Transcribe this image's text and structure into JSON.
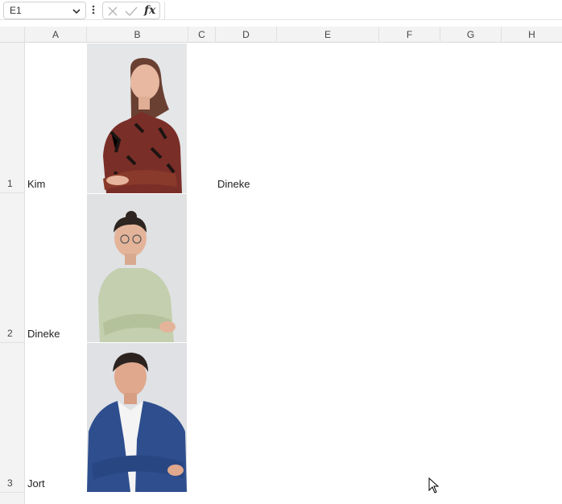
{
  "formula_bar": {
    "name_box": "E1",
    "fx_label": "fx",
    "formula": ""
  },
  "columns": [
    "A",
    "B",
    "C",
    "D",
    "E",
    "F",
    "G",
    "H"
  ],
  "rows": [
    "1",
    "2",
    "3"
  ],
  "cells": {
    "A1": "Kim",
    "A2": "Dineke",
    "A3": "Jort",
    "D1": "Dineke"
  },
  "icons": {
    "name_box_dropdown": "chevron-down-icon",
    "more": "vertical-dots-icon",
    "cancel": "x-icon",
    "enter": "checkmark-icon",
    "cursor": "mouse-pointer-icon"
  },
  "photos": [
    {
      "name": "photo-kim",
      "shirt": "floral red/black blouse"
    },
    {
      "name": "photo-dineke",
      "shirt": "light green patterned shirt"
    },
    {
      "name": "photo-jort",
      "shirt": "blue blazer, white shirt"
    }
  ]
}
